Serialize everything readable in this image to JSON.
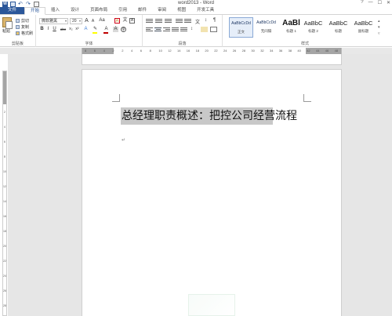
{
  "window": {
    "title": "word2013 - Word",
    "controls": [
      "?",
      "—",
      "☐",
      "✕"
    ]
  },
  "quick_access": {
    "icons": [
      "word-icon",
      "save-icon",
      "undo-icon",
      "redo-icon",
      "print-preview-icon"
    ]
  },
  "tabs": [
    "文件",
    "开始",
    "插入",
    "设计",
    "页面布局",
    "引用",
    "邮件",
    "审阅",
    "视图",
    "开发工具"
  ],
  "clipboard": {
    "paste": "粘贴",
    "cut": "剪切",
    "copy": "复制",
    "format_painter": "格式刷",
    "group": "剪贴板"
  },
  "font": {
    "name": "微软雅黑",
    "size": "20",
    "grow": "A",
    "shrink": "A",
    "change_case": "Aa",
    "clear_format": "A",
    "bold": "B",
    "italic": "I",
    "underline": "U",
    "strike": "abc",
    "subscript": "x₂",
    "superscript": "x²",
    "group": "字体",
    "highlight_color": "#ffff00",
    "font_color": "#c00000"
  },
  "paragraph": {
    "group": "段落"
  },
  "styles": {
    "group": "样式",
    "items": [
      {
        "sample": "AaBbCcDd",
        "name": "正文"
      },
      {
        "sample": "AaBbCcDd",
        "name": "无间隔"
      },
      {
        "sample": "AaBl",
        "name": "标题 1"
      },
      {
        "sample": "AaBbC",
        "name": "标题 2"
      },
      {
        "sample": "AaBbC",
        "name": "标题"
      },
      {
        "sample": "AaBbC",
        "name": "副标题"
      }
    ]
  },
  "ruler": {
    "ticks": [
      "8",
      "6",
      "4",
      "2",
      "2",
      "4",
      "6",
      "8",
      "10",
      "12",
      "14",
      "16",
      "18",
      "20",
      "22",
      "24",
      "26",
      "28",
      "30",
      "32",
      "34",
      "36",
      "38",
      "40",
      "42",
      "44",
      "46",
      "48"
    ]
  },
  "vruler": {
    "ticks": [
      "2",
      "4",
      "6",
      "8",
      "10",
      "12",
      "14",
      "16",
      "18",
      "20",
      "22",
      "24",
      "26",
      "28"
    ]
  },
  "document": {
    "heading": "总经理职责概述：把控公司经营流程",
    "para_mark": "↵"
  },
  "colors": {
    "accent": "#2b579a",
    "selection": "#c8c8c8",
    "clear_format_box": "#d0021b"
  }
}
